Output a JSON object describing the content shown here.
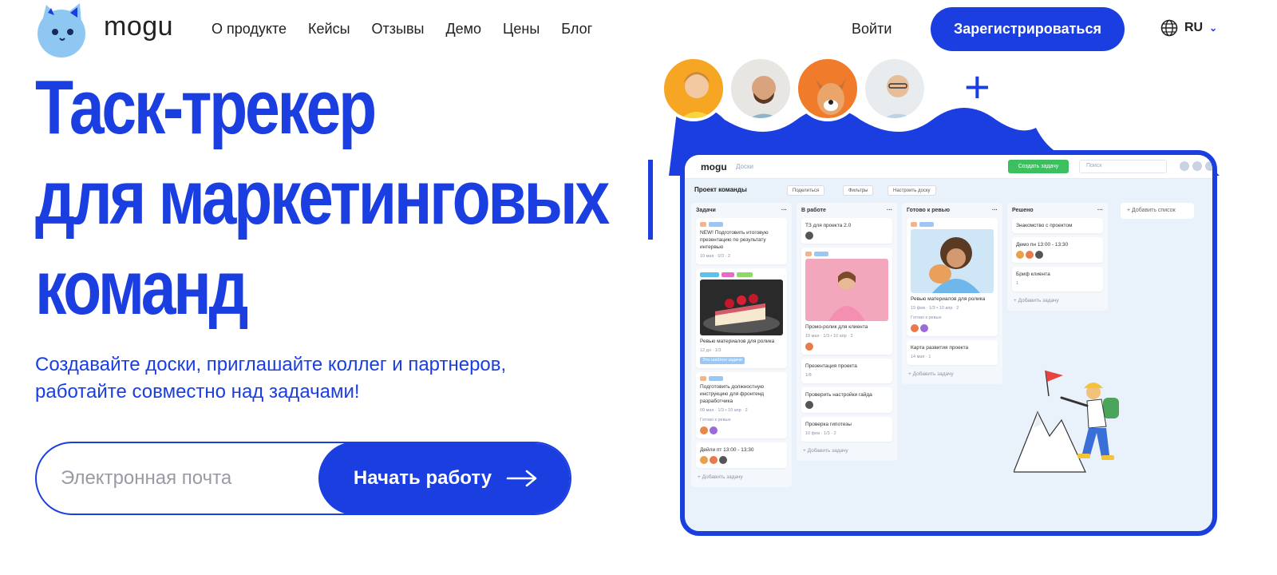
{
  "nav": {
    "logo_text": "mogu",
    "menu": [
      "О продукте",
      "Кейсы",
      "Отзывы",
      "Демо",
      "Цены",
      "Блог"
    ],
    "login": "Войти",
    "signup": "Зарегистрироваться",
    "lang": "RU"
  },
  "hero": {
    "headline": [
      "Таск-трекер",
      "для маркетинговых",
      "команд"
    ],
    "subtitle": "Создавайте доски, приглашайте коллег и партнеров, работайте совместно над задачами!",
    "email_placeholder": "Электронная почта",
    "cta_label": "Начать работу"
  },
  "board": {
    "app_name": "mogu",
    "boards_label": "Доски",
    "create_task": "Создать задачу",
    "search_placeholder": "Поиск",
    "project_title": "Проект команды",
    "chips": [
      "Поделиться",
      "Фильтры",
      "Настроить доску"
    ],
    "add_list": "+ Добавить список",
    "add_task": "+ Добавить задачу",
    "columns": [
      {
        "title": "Задачи",
        "cards": [
          {
            "text": "NEW! Подготовить итоговую презентацию по результату интервью",
            "meta": "10 мая · 0/3 · 2"
          },
          {
            "text": "Ревью материалов для ролика",
            "meta": "12 дн · 1/3",
            "tag": "Это шаблон задачи"
          },
          {
            "text": "Подготовить должностную инструкцию для фронтенд разработчика",
            "meta": "09 мая · 1/3 • 10 апр · 2",
            "status": "Готово к ревью"
          },
          {
            "text": "Дейли пт 13:00 - 13:30",
            "meta": ""
          }
        ]
      },
      {
        "title": "В работе",
        "cards": [
          {
            "text": "ТЗ для проекта 2.0",
            "meta": ""
          },
          {
            "text": "Промо-ролик для клиента",
            "meta": "19 мая · 1/3 • 10 апр · 2"
          },
          {
            "text": "Презентация проекта",
            "meta": "1/8"
          },
          {
            "text": "Проверить настройки гайда",
            "meta": ""
          },
          {
            "text": "Проверка гипотезы",
            "meta": "10 фев · 1/3 · 2"
          }
        ]
      },
      {
        "title": "Готово к ревью",
        "cards": [
          {
            "text": "Ревью материалов для ролика",
            "meta": "19 фев · 1/3 • 10 апр · 2",
            "status": "Готово к ревью"
          },
          {
            "text": "Карта развития проекта",
            "meta": "14 мая · 1"
          }
        ]
      },
      {
        "title": "Решено",
        "cards": [
          {
            "text": "Знакомство с проектом",
            "meta": ""
          },
          {
            "text": "Демо пн 13:00 - 13:30",
            "meta": ""
          },
          {
            "text": "Бриф клиента",
            "meta": "1"
          }
        ]
      }
    ]
  },
  "colors": {
    "brand_blue": "#1a3ee0",
    "green": "#3bbf5f",
    "board_bg": "#e9f1fb"
  },
  "icons": [
    "cat-logo-icon",
    "globe-icon",
    "chevron-down-icon",
    "arrow-right-icon",
    "plus-icon"
  ]
}
